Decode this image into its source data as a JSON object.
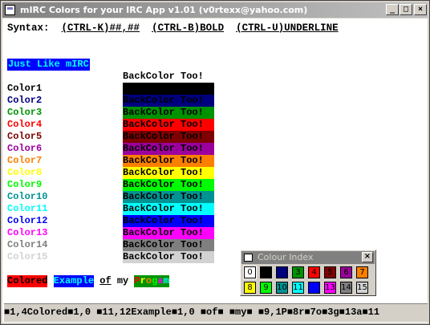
{
  "window": {
    "title": "mIRC Colors for your IRC App v1.01 (v0rtexx@yahoo.com)",
    "buttons": {
      "minimize": "_",
      "maximize": "□",
      "close": "×"
    }
  },
  "syntax": {
    "label": "Syntax:",
    "items": [
      "(CTRL-K)##,##",
      "(CTRL-B)BOLD",
      "(CTRL-U)UNDERLINE"
    ]
  },
  "just_like": "Just Like mIRC",
  "backcolor_header": "BackColor Too!",
  "colors": [
    {
      "label": "Color1",
      "fg": "#000000",
      "bg": "#000000",
      "text": "BackColor Too!"
    },
    {
      "label": "Color2",
      "fg": "#00007f",
      "bg": "#00007f",
      "text": "BackColor Too!"
    },
    {
      "label": "Color3",
      "fg": "#009300",
      "bg": "#009300",
      "text": "BackColor Too!"
    },
    {
      "label": "Color4",
      "fg": "#ff0000",
      "bg": "#ff0000",
      "text": "BackColor Too!"
    },
    {
      "label": "Color5",
      "fg": "#7f0000",
      "bg": "#7f0000",
      "text": "BackColor Too!"
    },
    {
      "label": "Color6",
      "fg": "#9c009c",
      "bg": "#9c009c",
      "text": "BackColor Too!"
    },
    {
      "label": "Color7",
      "fg": "#fc7f00",
      "bg": "#fc7f00",
      "text": "BackColor Too!"
    },
    {
      "label": "Color8",
      "fg": "#ffff00",
      "bg": "#ffff00",
      "text": "BackColor Too!"
    },
    {
      "label": "Color9",
      "fg": "#00fc00",
      "bg": "#00fc00",
      "text": "BackColor Too!"
    },
    {
      "label": "Color10",
      "fg": "#009393",
      "bg": "#009393",
      "text": "BackColor Too!"
    },
    {
      "label": "Color11",
      "fg": "#00ffff",
      "bg": "#00ffff",
      "text": "BackColor Too!"
    },
    {
      "label": "Color12",
      "fg": "#0000fc",
      "bg": "#0000fc",
      "text": "BackColor Too!"
    },
    {
      "label": "Color13",
      "fg": "#ff00ff",
      "bg": "#ff00ff",
      "text": "BackColor Too!"
    },
    {
      "label": "Color14",
      "fg": "#7f7f7f",
      "bg": "#7f7f7f",
      "text": "BackColor Too!"
    },
    {
      "label": "Color15",
      "fg": "#d2d2d2",
      "bg": "#d2d2d2",
      "text": "BackColor Too!"
    }
  ],
  "sample": [
    {
      "text": "Colored",
      "fg": "#000000",
      "bg": "#ff0000",
      "underline": false
    },
    {
      "text": " ",
      "fg": "#000000",
      "bg": "#ffffff",
      "underline": false
    },
    {
      "text": "Example",
      "fg": "#00ffff",
      "bg": "#0000fc",
      "underline": false
    },
    {
      "text": " ",
      "fg": "#000000",
      "bg": "#ffffff",
      "underline": false
    },
    {
      "text": "of",
      "fg": "#000000",
      "bg": "#ffffff",
      "underline": true
    },
    {
      "text": " my ",
      "fg": "#000000",
      "bg": "#ffffff",
      "underline": false
    },
    {
      "text": "P",
      "fg": "#ff0000",
      "bg": "#009300",
      "underline": false
    },
    {
      "text": "r",
      "fg": "#ffff00",
      "bg": "#009300",
      "underline": false
    },
    {
      "text": "o",
      "fg": "#fc7f00",
      "bg": "#009300",
      "underline": false
    },
    {
      "text": "g",
      "fg": "#00fc00",
      "bg": "#009300",
      "underline": false
    },
    {
      "text": "a",
      "fg": "#ff00ff",
      "bg": "#009300",
      "underline": false
    },
    {
      "text": "m",
      "fg": "#00ffff",
      "bg": "#009300",
      "underline": false
    }
  ],
  "statusbar": "■1,4Colored■1,0 ■11,12Example■1,0 ■of■ ■my■ ■9,1P■8r■7o■3g■13a■11",
  "palette": {
    "title": "Colour Index",
    "close": "×",
    "rows": [
      [
        {
          "label": "0",
          "bg": "#ffffff",
          "fg": "#000000"
        },
        {
          "label": "1",
          "bg": "#000000",
          "fg": "#000000"
        },
        {
          "label": "2",
          "bg": "#00007f",
          "fg": "#00007f"
        },
        {
          "label": "3",
          "bg": "#009300",
          "fg": "#000000"
        },
        {
          "label": "4",
          "bg": "#ff0000",
          "fg": "#000000"
        },
        {
          "label": "5",
          "bg": "#7f0000",
          "fg": "#000000"
        },
        {
          "label": "6",
          "bg": "#9c009c",
          "fg": "#000000"
        },
        {
          "label": "7",
          "bg": "#fc7f00",
          "fg": "#000000"
        }
      ],
      [
        {
          "label": "8",
          "bg": "#ffff00",
          "fg": "#000000"
        },
        {
          "label": "9",
          "bg": "#00fc00",
          "fg": "#000000"
        },
        {
          "label": "10",
          "bg": "#009393",
          "fg": "#000000"
        },
        {
          "label": "11",
          "bg": "#00ffff",
          "fg": "#000000"
        },
        {
          "label": "12",
          "bg": "#0000fc",
          "fg": "#0000fc"
        },
        {
          "label": "13",
          "bg": "#ff00ff",
          "fg": "#000000"
        },
        {
          "label": "14",
          "bg": "#7f7f7f",
          "fg": "#000000"
        },
        {
          "label": "15",
          "bg": "#d2d2d2",
          "fg": "#000000"
        }
      ]
    ]
  }
}
